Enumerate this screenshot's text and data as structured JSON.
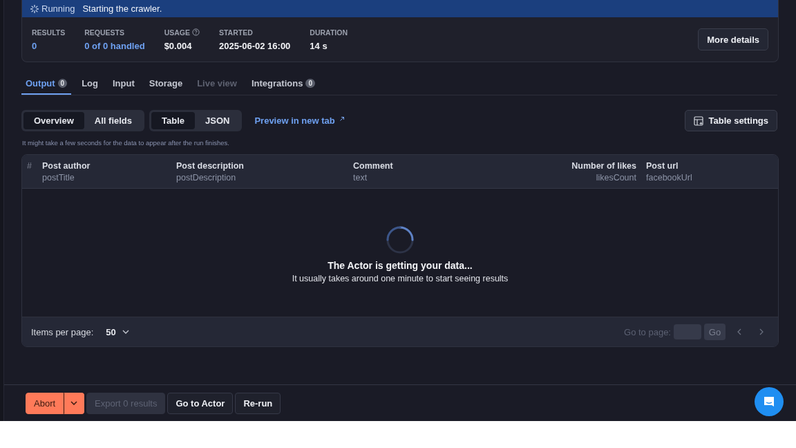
{
  "status": {
    "label": "Running",
    "message": "Starting the crawler."
  },
  "stats": [
    {
      "label": "RESULTS",
      "value": "0",
      "kind": "link",
      "help": false
    },
    {
      "label": "REQUESTS",
      "value": "0 of 0 handled",
      "kind": "link",
      "help": false
    },
    {
      "label": "USAGE",
      "value": "$0.004",
      "kind": "plain",
      "help": true
    },
    {
      "label": "STARTED",
      "value": "2025-06-02 16:00",
      "kind": "plain",
      "help": false
    },
    {
      "label": "DURATION",
      "value": "14 s",
      "kind": "plain",
      "help": false
    }
  ],
  "more_details": "More details",
  "tabs": [
    {
      "label": "Output",
      "count": "0",
      "selected": true,
      "disabled": false
    },
    {
      "label": "Log",
      "selected": false,
      "disabled": false
    },
    {
      "label": "Input",
      "selected": false,
      "disabled": false
    },
    {
      "label": "Storage",
      "selected": false,
      "disabled": false
    },
    {
      "label": "Live view",
      "selected": false,
      "disabled": true
    },
    {
      "label": "Integrations",
      "count": "0",
      "selected": false,
      "disabled": false
    }
  ],
  "view_toggles": [
    [
      {
        "label": "Overview",
        "selected": true
      },
      {
        "label": "All fields",
        "selected": false
      }
    ],
    [
      {
        "label": "Table",
        "selected": true
      },
      {
        "label": "JSON",
        "selected": false
      }
    ]
  ],
  "preview_link": "Preview in new tab",
  "table_settings": "Table settings",
  "hint": "It might take a few seconds for the data to appear after the run finishes.",
  "table": {
    "columns": [
      {
        "title": "#",
        "kind": "index"
      },
      {
        "title": "Post author",
        "field": "postTitle",
        "kind": "text"
      },
      {
        "title": "Post description",
        "field": "postDescription",
        "kind": "text"
      },
      {
        "title": "Comment",
        "field": "text",
        "kind": "text"
      },
      {
        "title": "Number of likes",
        "field": "likesCount",
        "kind": "number"
      },
      {
        "title": "Post url",
        "field": "facebookUrl",
        "kind": "text"
      }
    ],
    "loading": {
      "title": "The Actor is getting your data...",
      "subtitle": "It usually takes around one minute to start seeing results"
    },
    "footer": {
      "items_label": "Items per page:",
      "items_value": "50",
      "goto_label": "Go to page:",
      "go": "Go",
      "pager_disabled": true
    }
  },
  "actions": [
    {
      "label": "Abort",
      "kind": "danger",
      "disabled": false
    },
    {
      "label": "Export 0 results",
      "kind": "default",
      "disabled": true
    },
    {
      "label": "Go to Actor",
      "kind": "default",
      "disabled": false
    },
    {
      "label": "Re-run",
      "kind": "default",
      "disabled": false
    }
  ]
}
